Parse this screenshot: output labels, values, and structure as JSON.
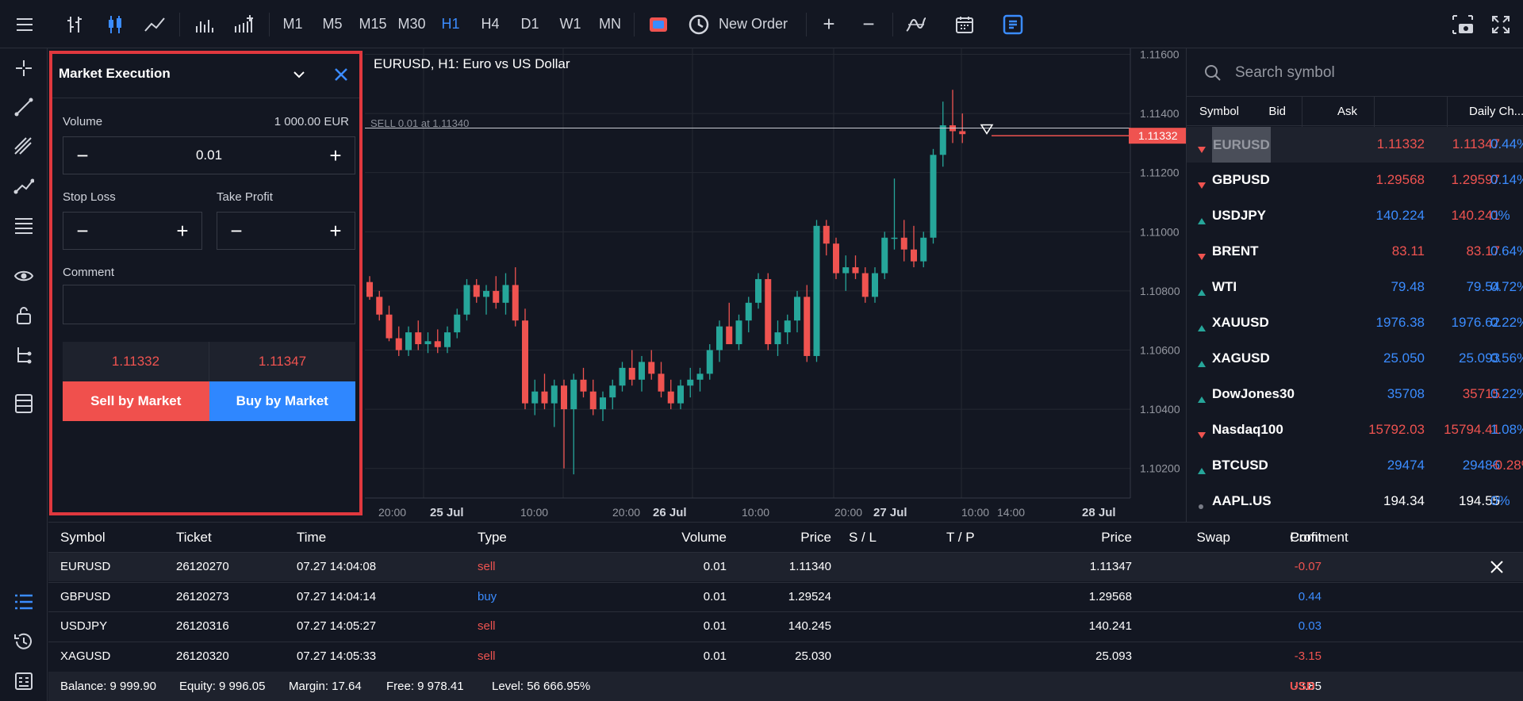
{
  "toolbar": {
    "timeframes": [
      "M1",
      "M5",
      "M15",
      "M30",
      "H1",
      "H4",
      "D1",
      "W1",
      "MN"
    ],
    "active_timeframe": "H1",
    "new_order_label": "New Order",
    "plus": "+",
    "minus": "−"
  },
  "order_panel": {
    "title": "Market Execution",
    "volume_label": "Volume",
    "volume_amount": "1 000.00 EUR",
    "volume_value": "0.01",
    "stop_loss_label": "Stop Loss",
    "take_profit_label": "Take Profit",
    "comment_label": "Comment",
    "sell_price": "1.11332",
    "buy_price": "1.11347",
    "sell_button": "Sell by Market",
    "buy_button": "Buy by Market",
    "minus": "−",
    "plus": "+"
  },
  "chart": {
    "title": "EURUSD, H1: Euro vs US Dollar",
    "sell_line_label": "SELL 0.01 at 1.11340",
    "current_price": "1.11332",
    "price_ticks": [
      "1.11600",
      "1.11400",
      "1.11200",
      "1.11000",
      "1.10800",
      "1.10600",
      "1.10400",
      "1.10200"
    ],
    "time_labels": [
      "20:00",
      "25 Jul",
      "10:00",
      "20:00",
      "26 Jul",
      "10:00",
      "20:00",
      "27 Jul",
      "10:00",
      "14:00",
      "28 Jul"
    ],
    "colors": {
      "up": "#26a69a",
      "down": "#ef5350"
    }
  },
  "chart_data": {
    "type": "candlestick",
    "title": "EURUSD, H1: Euro vs US Dollar",
    "ylim": [
      1.101,
      1.1162
    ],
    "series": [
      {
        "name": "EURUSD",
        "values": [
          [
            1.1083,
            1.1085,
            1.1077,
            1.1078
          ],
          [
            1.1078,
            1.108,
            1.107,
            1.1072
          ],
          [
            1.1072,
            1.1075,
            1.1063,
            1.1064
          ],
          [
            1.1064,
            1.1068,
            1.1058,
            1.106
          ],
          [
            1.106,
            1.1068,
            1.1058,
            1.1066
          ],
          [
            1.1066,
            1.107,
            1.106,
            1.1062
          ],
          [
            1.1062,
            1.1066,
            1.1059,
            1.1063
          ],
          [
            1.1063,
            1.1067,
            1.1059,
            1.1061
          ],
          [
            1.1061,
            1.1068,
            1.1059,
            1.1066
          ],
          [
            1.1066,
            1.1074,
            1.1064,
            1.1072
          ],
          [
            1.1072,
            1.1084,
            1.107,
            1.1082
          ],
          [
            1.1082,
            1.1084,
            1.1076,
            1.1078
          ],
          [
            1.1078,
            1.1082,
            1.1072,
            1.108
          ],
          [
            1.108,
            1.1085,
            1.1074,
            1.1076
          ],
          [
            1.1076,
            1.1086,
            1.1072,
            1.1082
          ],
          [
            1.1082,
            1.1088,
            1.1068,
            1.107
          ],
          [
            1.107,
            1.1074,
            1.104,
            1.1042
          ],
          [
            1.1042,
            1.105,
            1.1038,
            1.1046
          ],
          [
            1.1046,
            1.1052,
            1.104,
            1.1042
          ],
          [
            1.1042,
            1.105,
            1.1034,
            1.1048
          ],
          [
            1.1048,
            1.105,
            1.102,
            1.104
          ],
          [
            1.104,
            1.1052,
            1.1018,
            1.105
          ],
          [
            1.105,
            1.1054,
            1.1044,
            1.1046
          ],
          [
            1.1046,
            1.105,
            1.1038,
            1.104
          ],
          [
            1.104,
            1.1046,
            1.1036,
            1.1044
          ],
          [
            1.1044,
            1.105,
            1.104,
            1.1048
          ],
          [
            1.1048,
            1.1056,
            1.1046,
            1.1054
          ],
          [
            1.1054,
            1.106,
            1.1048,
            1.105
          ],
          [
            1.105,
            1.1058,
            1.1046,
            1.1056
          ],
          [
            1.1056,
            1.106,
            1.105,
            1.1052
          ],
          [
            1.1052,
            1.1056,
            1.1044,
            1.1046
          ],
          [
            1.1046,
            1.105,
            1.104,
            1.1042
          ],
          [
            1.1042,
            1.105,
            1.104,
            1.1048
          ],
          [
            1.1048,
            1.1054,
            1.1044,
            1.105
          ],
          [
            1.105,
            1.1054,
            1.1046,
            1.1052
          ],
          [
            1.1052,
            1.1062,
            1.105,
            1.106
          ],
          [
            1.106,
            1.107,
            1.1056,
            1.1068
          ],
          [
            1.1068,
            1.1076,
            1.1064,
            1.1062
          ],
          [
            1.1062,
            1.1072,
            1.106,
            1.107
          ],
          [
            1.107,
            1.1078,
            1.1066,
            1.1076
          ],
          [
            1.1076,
            1.1086,
            1.1074,
            1.1084
          ],
          [
            1.1084,
            1.1086,
            1.106,
            1.1062
          ],
          [
            1.1062,
            1.107,
            1.1058,
            1.1066
          ],
          [
            1.1066,
            1.1072,
            1.1062,
            1.107
          ],
          [
            1.107,
            1.108,
            1.1066,
            1.1078
          ],
          [
            1.1078,
            1.1082,
            1.1056,
            1.1058
          ],
          [
            1.1058,
            1.1104,
            1.1056,
            1.1102
          ],
          [
            1.1102,
            1.1104,
            1.1092,
            1.1096
          ],
          [
            1.1096,
            1.1098,
            1.1084,
            1.1086
          ],
          [
            1.1086,
            1.1092,
            1.108,
            1.1088
          ],
          [
            1.1088,
            1.1092,
            1.1084,
            1.1086
          ],
          [
            1.1086,
            1.1088,
            1.1076,
            1.1078
          ],
          [
            1.1078,
            1.1088,
            1.1076,
            1.1086
          ],
          [
            1.1086,
            1.11,
            1.1084,
            1.1098
          ],
          [
            1.1098,
            1.1118,
            1.1094,
            1.1098
          ],
          [
            1.1098,
            1.1104,
            1.109,
            1.1094
          ],
          [
            1.1094,
            1.1102,
            1.1088,
            1.109
          ],
          [
            1.109,
            1.11,
            1.1088,
            1.1098
          ],
          [
            1.1098,
            1.1128,
            1.1096,
            1.1126
          ],
          [
            1.1126,
            1.1144,
            1.1122,
            1.1136
          ],
          [
            1.1136,
            1.1148,
            1.113,
            1.1134
          ],
          [
            1.1134,
            1.114,
            1.113,
            1.1133
          ]
        ]
      }
    ]
  },
  "watchlist": {
    "search_placeholder": "Search symbol",
    "headers": {
      "symbol": "Symbol",
      "bid": "Bid",
      "ask": "Ask",
      "change": "Daily Ch..."
    },
    "rows": [
      {
        "symbol": "EURUSD",
        "dir": "down",
        "bid": "1.11332",
        "ask": "1.11347",
        "change": "0.44%",
        "bid_color": "red",
        "ask_color": "red",
        "chg_color": "blue"
      },
      {
        "symbol": "GBPUSD",
        "dir": "down",
        "bid": "1.29568",
        "ask": "1.29597",
        "change": "0.14%",
        "bid_color": "red",
        "ask_color": "red",
        "chg_color": "blue"
      },
      {
        "symbol": "USDJPY",
        "dir": "up",
        "bid": "140.224",
        "ask": "140.241",
        "change": "0%",
        "bid_color": "blue",
        "ask_color": "red",
        "chg_color": "blue"
      },
      {
        "symbol": "BRENT",
        "dir": "down",
        "bid": "83.11",
        "ask": "83.17",
        "change": "0.64%",
        "bid_color": "red",
        "ask_color": "red",
        "chg_color": "blue"
      },
      {
        "symbol": "WTI",
        "dir": "up",
        "bid": "79.48",
        "ask": "79.54",
        "change": "0.72%",
        "bid_color": "blue",
        "ask_color": "blue",
        "chg_color": "blue"
      },
      {
        "symbol": "XAUUSD",
        "dir": "up",
        "bid": "1976.38",
        "ask": "1976.62",
        "change": "0.22%",
        "bid_color": "blue",
        "ask_color": "blue",
        "chg_color": "blue"
      },
      {
        "symbol": "XAGUSD",
        "dir": "up",
        "bid": "25.050",
        "ask": "25.093",
        "change": "0.56%",
        "bid_color": "blue",
        "ask_color": "blue",
        "chg_color": "blue"
      },
      {
        "symbol": "DowJones30",
        "dir": "up",
        "bid": "35708",
        "ask": "35715",
        "change": "0.22%",
        "bid_color": "blue",
        "ask_color": "red",
        "chg_color": "blue"
      },
      {
        "symbol": "Nasdaq100",
        "dir": "down",
        "bid": "15792.03",
        "ask": "15794.41",
        "change": "1.08%",
        "bid_color": "red",
        "ask_color": "red",
        "chg_color": "blue"
      },
      {
        "symbol": "BTCUSD",
        "dir": "up",
        "bid": "29474",
        "ask": "29486",
        "change": "-0.28%",
        "bid_color": "blue",
        "ask_color": "blue",
        "chg_color": "red"
      },
      {
        "symbol": "AAPL.US",
        "dir": "none",
        "bid": "194.34",
        "ask": "194.55",
        "change": "0%",
        "bid_color": "white",
        "ask_color": "white",
        "chg_color": "blue"
      }
    ]
  },
  "positions": {
    "headers": {
      "symbol": "Symbol",
      "ticket": "Ticket",
      "time": "Time",
      "type": "Type",
      "volume": "Volume",
      "price": "Price",
      "sl": "S / L",
      "tp": "T / P",
      "cur_price": "Price",
      "swap": "Swap",
      "profit": "Profit",
      "comment": "Comment"
    },
    "rows": [
      {
        "symbol": "EURUSD",
        "ticket": "26120270",
        "time": "07.27 14:04:08",
        "type": "sell",
        "volume": "0.01",
        "price": "1.11340",
        "cur_price": "1.11347",
        "profit": "-0.07",
        "profit_color": "red",
        "type_color": "red"
      },
      {
        "symbol": "GBPUSD",
        "ticket": "26120273",
        "time": "07.27 14:04:14",
        "type": "buy",
        "volume": "0.01",
        "price": "1.29524",
        "cur_price": "1.29568",
        "profit": "0.44",
        "profit_color": "blue",
        "type_color": "blue"
      },
      {
        "symbol": "USDJPY",
        "ticket": "26120316",
        "time": "07.27 14:05:27",
        "type": "sell",
        "volume": "0.01",
        "price": "140.245",
        "cur_price": "140.241",
        "profit": "0.03",
        "profit_color": "blue",
        "type_color": "red"
      },
      {
        "symbol": "XAGUSD",
        "ticket": "26120320",
        "time": "07.27 14:05:33",
        "type": "sell",
        "volume": "0.01",
        "price": "25.030",
        "cur_price": "25.093",
        "profit": "-3.15",
        "profit_color": "red",
        "type_color": "red"
      }
    ],
    "footer": {
      "balance": "Balance: 9 999.90",
      "equity": "Equity: 9 996.05",
      "margin": "Margin: 17.64",
      "free": "Free: 9 978.41",
      "level": "Level: 56 666.95%",
      "total_profit": "-3.85",
      "currency": "USD"
    }
  }
}
